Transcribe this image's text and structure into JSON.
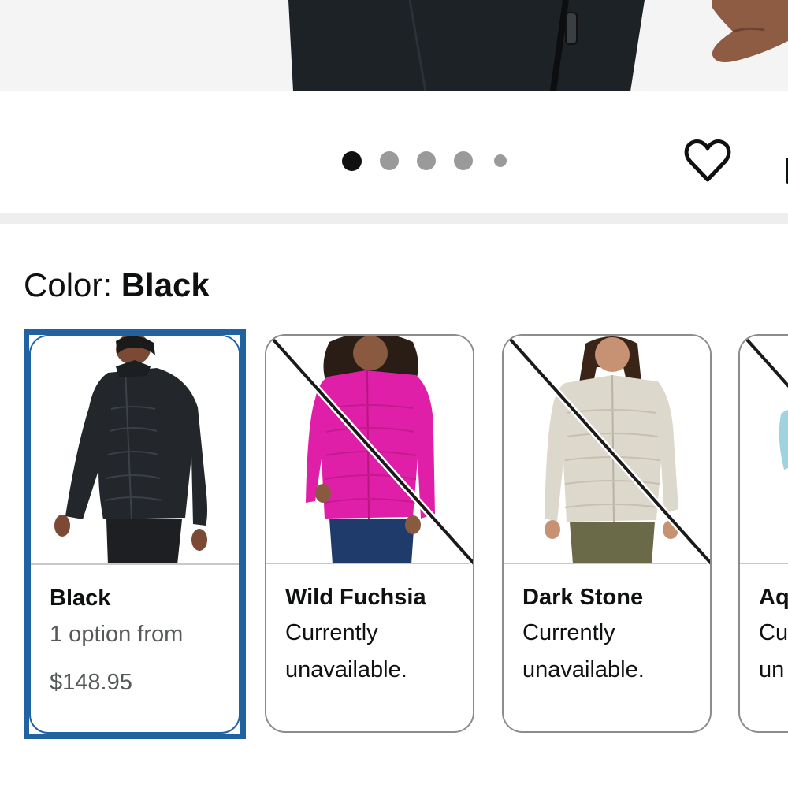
{
  "product": {
    "image_carousel": {
      "total_images": 5,
      "active_index": 0
    },
    "actions": {
      "wishlist_icon": "heart-icon",
      "share_icon": "share-icon"
    }
  },
  "color_selector": {
    "label": "Color: ",
    "selected_value": "Black",
    "options": [
      {
        "name": "Black",
        "subtext": "1 option from",
        "price": "$148.95",
        "available": true,
        "selected": true,
        "image_icon": "jacket-black-thumbnail"
      },
      {
        "name": "Wild Fuchsia",
        "status_line1": "Currently",
        "status_line2": "unavailable.",
        "available": false,
        "selected": false,
        "image_icon": "jacket-fuchsia-thumbnail"
      },
      {
        "name": "Dark Stone",
        "status_line1": "Currently",
        "status_line2": "unavailable.",
        "available": false,
        "selected": false,
        "image_icon": "jacket-stone-thumbnail"
      },
      {
        "name": "Aq",
        "status_line1": "Cu",
        "status_line2": "un",
        "available": false,
        "selected": false,
        "image_icon": "jacket-aqua-thumbnail"
      }
    ]
  },
  "colors": {
    "selected_border": "#2162a1",
    "swatch_border": "#8c8c8c",
    "active_dot": "#0f1111",
    "inactive_dot": "#9a9a9a",
    "subtext": "#565959"
  }
}
